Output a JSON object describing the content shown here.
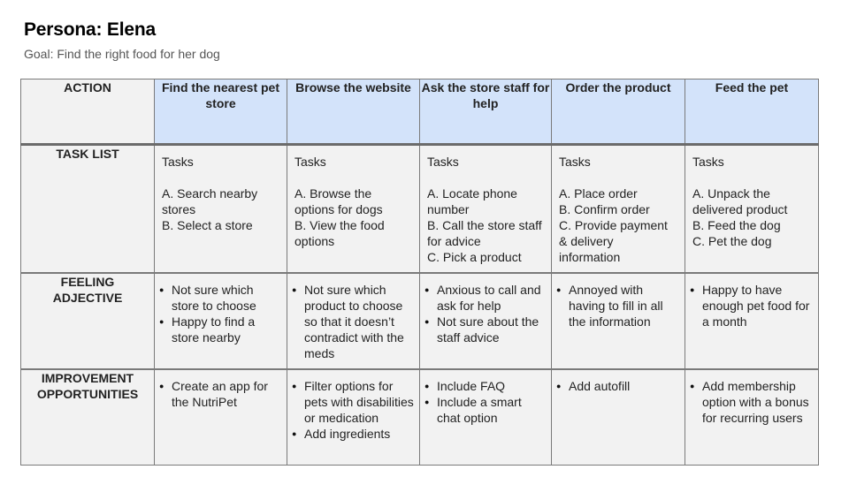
{
  "header": {
    "title": "Persona: Elena",
    "goal": "Goal: Find the right food for her dog"
  },
  "table": {
    "row_headers": {
      "action": "ACTION",
      "task_list": "TASK LIST",
      "feeling_line1": "FEELING",
      "feeling_line2": "ADJECTIVE",
      "improvement_line1": "IMPROVEMENT",
      "improvement_line2": "OPPORTUNITIES"
    },
    "columns": [
      {
        "action": "Find the nearest pet store",
        "tasks_label": "Tasks",
        "tasks": [
          "A. Search nearby stores",
          "B. Select a store"
        ],
        "feelings": [
          "Not sure which store to choose",
          "Happy to find a store nearby"
        ],
        "improvements": [
          "Create an app for the NutriPet"
        ]
      },
      {
        "action": "Browse the website",
        "tasks_label": "Tasks",
        "tasks": [
          "A. Browse the options for dogs",
          "B. View the food options"
        ],
        "feelings": [
          "Not sure which product to choose so that it doesn’t contradict with the meds"
        ],
        "improvements": [
          "Filter options for pets with disabilities or medication",
          "Add ingredients"
        ]
      },
      {
        "action": "Ask the store staff for help",
        "tasks_label": "Tasks",
        "tasks": [
          "A. Locate phone number",
          "B. Call the store staff for advice",
          "C. Pick a product"
        ],
        "feelings": [
          "Anxious to call and ask for help",
          "Not sure about the staff advice"
        ],
        "improvements": [
          "Include FAQ",
          "Include a smart chat option"
        ]
      },
      {
        "action": "Order the product",
        "tasks_label": "Tasks",
        "tasks": [
          "A. Place order",
          "B. Confirm order",
          "C. Provide payment & delivery information"
        ],
        "feelings": [
          "Annoyed with having to fill in all the information"
        ],
        "improvements": [
          "Add autofill"
        ]
      },
      {
        "action": "Feed the pet",
        "tasks_label": "Tasks",
        "tasks": [
          "A. Unpack the delivered product",
          "B. Feed the dog",
          "C. Pet the dog"
        ],
        "feelings": [
          "Happy to have enough pet food for a month"
        ],
        "improvements": [
          "Add membership option with a bonus for recurring users"
        ]
      }
    ]
  },
  "colors": {
    "header_fill": "#d3e3fa",
    "cell_fill": "#f2f2f2",
    "border": "#7a7a7a"
  }
}
